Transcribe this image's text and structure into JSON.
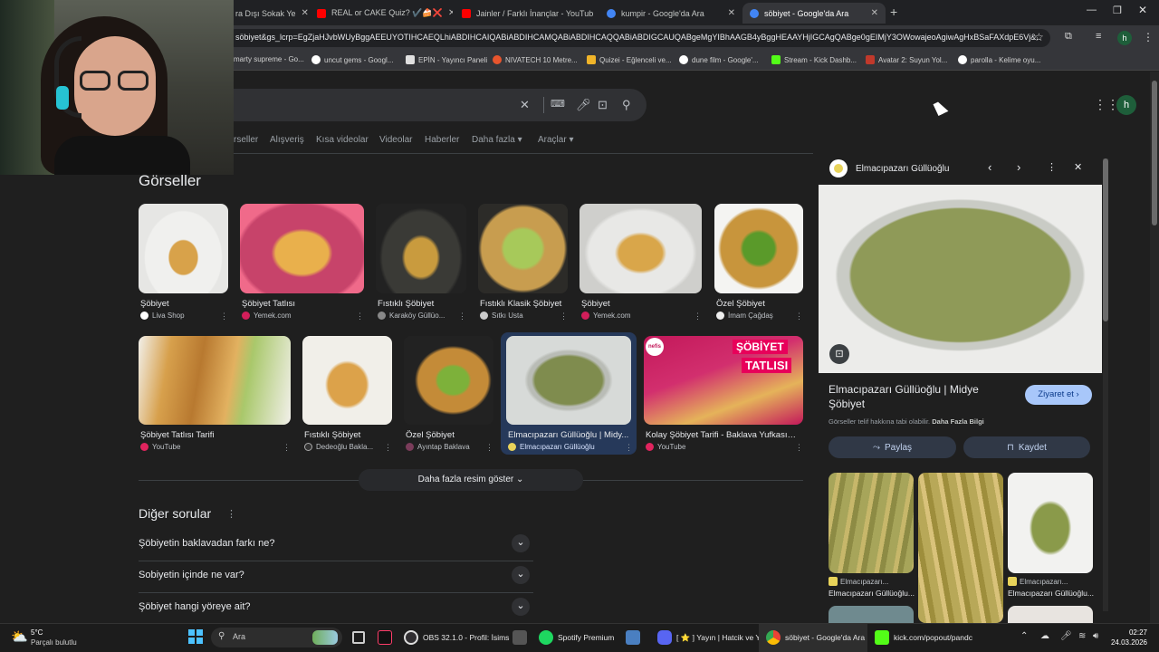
{
  "browser": {
    "tabs": [
      {
        "label": "ra Dışı Sokak Ye",
        "active": false
      },
      {
        "label": "REAL or CAKE Quiz? ✔️🍰❌",
        "active": false
      },
      {
        "label": "Jainler / Farklı İnançlar - YouTub",
        "active": false
      },
      {
        "label": "kumpir - Google'da Ara",
        "active": false
      },
      {
        "label": "söbiyet - Google'da Ara",
        "active": true
      }
    ],
    "url": "söbiyet&gs_lcrp=EgZjaHJvbWUyBggAEEUYOTIHCAEQLhiABDIHCAIQABiABDIHCAMQABiABDIHCAQQABiABDIGCAUQABgeMgYIBhAAGB4yBggHEAAYHjIGCAgQABge0gEIMjY3OWowajeoAgiwAgHxBSaFAXdpE6Vj&..",
    "bookmarks": [
      "marty supreme - Go...",
      "uncut gems - Googl...",
      "EPİN - Yayıncı Paneli",
      "NIVATECH 10 Metre...",
      "Quizei - Eğlenceli ve...",
      "dune film - Google'...",
      "Stream - Kick Dashb...",
      "Avatar 2: Suyun Yol...",
      "parolla - Kelime oyu..."
    ],
    "avatar_letter": "h"
  },
  "search": {
    "nav": [
      "rseller",
      "Alışveriş",
      "Kısa videolar",
      "Videolar",
      "Haberler",
      "Daha fazla",
      "Araçlar"
    ],
    "section_title": "Görseller",
    "images_row1": [
      {
        "caption": "Şöbiyet",
        "source": "Liva Shop",
        "color": "#ffffff"
      },
      {
        "caption": "Şöbiyet Tatlısı",
        "source": "Yemek.com",
        "color": "#d21e5a"
      },
      {
        "caption": "Fıstıklı Şöbiyet",
        "source": "Karaköy Güllüo...",
        "color": "#888888"
      },
      {
        "caption": "Fıstıklı Klasik Şöbiyet",
        "source": "Sıtkı Usta",
        "color": "#cccccc"
      },
      {
        "caption": "Şöbiyet",
        "source": "Yemek.com",
        "color": "#d21e5a"
      },
      {
        "caption": "Özel Şöbiyet",
        "source": "İmam Çağdaş",
        "color": "#eeeeee"
      }
    ],
    "images_row2": [
      {
        "caption": "Şöbiyet Tatlısı Tarifi",
        "source": "YouTube",
        "color": "#e0245e"
      },
      {
        "caption": "Fıstıklı Şöbiyet",
        "source": "Dedeoğlu Bakla...",
        "color": "#333333"
      },
      {
        "caption": "Özel Şöbiyet",
        "source": "Ayıntap Baklava",
        "color": "#7a3c5a"
      },
      {
        "caption": "Elmacıpazarı Güllüoğlu | Midy...",
        "source": "Elmacıpazarı Güllüoğlu",
        "color": "#e8d35a"
      },
      {
        "caption": "Kolay Şöbiyet Tarifi - Baklava Yufkası il...",
        "source": "YouTube",
        "color": "#e0245e"
      }
    ],
    "banner_text_1": "ŞÖBİYET",
    "banner_text_2": "TATLISI",
    "nefis": "nefis",
    "more_images": "Daha fazla resim göster",
    "questions_title": "Diğer sorular",
    "questions": [
      "Şöbiyetin baklavadan farkı ne?",
      "Sobiyetin içinde ne var?",
      "Şöbiyet hangi yöreye ait?"
    ]
  },
  "panel": {
    "source_name": "Elmacıpazarı Güllüoğlu",
    "title": "Elmacıpazarı Güllüoğlu | Midye Şöbiyet",
    "visit": "Ziyaret et",
    "copyright": "Görseller telif hakkına tabi olabilir.",
    "more_info": "Daha Fazla Bilgi",
    "share": "Paylaş",
    "save": "Kaydet",
    "related": [
      {
        "source": "Elmacıpazarı...",
        "title": "Elmacıpazarı Güllüoğlu..."
      },
      {
        "source": "",
        "title": ""
      },
      {
        "source": "Elmacıpazarı...",
        "title": "Elmacıpazarı Güllüoğlu..."
      }
    ]
  },
  "taskbar": {
    "weather_temp": "5°C",
    "weather_desc": "Parçalı bulutlu",
    "search": "Ara",
    "obs": "OBS 32.1.0 - Profil: İsims",
    "spotify": "Spotify Premium",
    "yayin": "[ ⭐ ] Yayın | Hatcik ve Y",
    "chrome": "söbiyet - Google'da Ara",
    "kick": "kick.com/popout/pandc",
    "time": "02:27",
    "date": "24.03.2026"
  }
}
